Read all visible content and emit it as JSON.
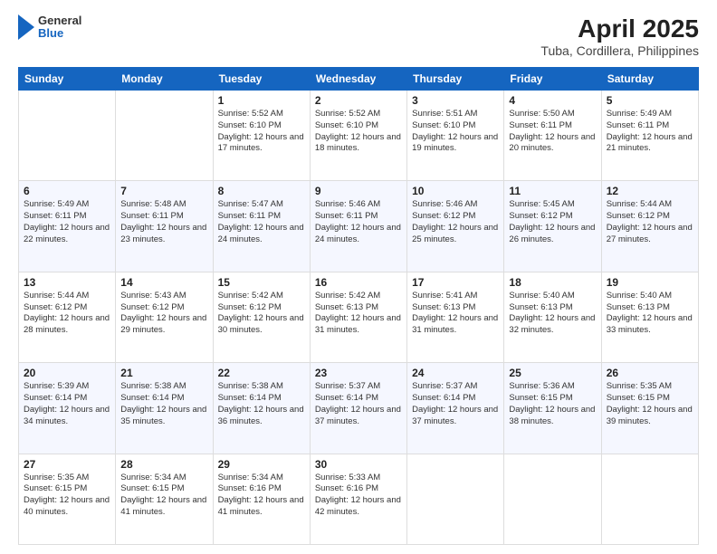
{
  "header": {
    "logo_general": "General",
    "logo_blue": "Blue",
    "title": "April 2025",
    "subtitle": "Tuba, Cordillera, Philippines"
  },
  "columns": [
    "Sunday",
    "Monday",
    "Tuesday",
    "Wednesday",
    "Thursday",
    "Friday",
    "Saturday"
  ],
  "weeks": [
    [
      {
        "day": "",
        "sunrise": "",
        "sunset": "",
        "daylight": ""
      },
      {
        "day": "",
        "sunrise": "",
        "sunset": "",
        "daylight": ""
      },
      {
        "day": "1",
        "sunrise": "Sunrise: 5:52 AM",
        "sunset": "Sunset: 6:10 PM",
        "daylight": "Daylight: 12 hours and 17 minutes."
      },
      {
        "day": "2",
        "sunrise": "Sunrise: 5:52 AM",
        "sunset": "Sunset: 6:10 PM",
        "daylight": "Daylight: 12 hours and 18 minutes."
      },
      {
        "day": "3",
        "sunrise": "Sunrise: 5:51 AM",
        "sunset": "Sunset: 6:10 PM",
        "daylight": "Daylight: 12 hours and 19 minutes."
      },
      {
        "day": "4",
        "sunrise": "Sunrise: 5:50 AM",
        "sunset": "Sunset: 6:11 PM",
        "daylight": "Daylight: 12 hours and 20 minutes."
      },
      {
        "day": "5",
        "sunrise": "Sunrise: 5:49 AM",
        "sunset": "Sunset: 6:11 PM",
        "daylight": "Daylight: 12 hours and 21 minutes."
      }
    ],
    [
      {
        "day": "6",
        "sunrise": "Sunrise: 5:49 AM",
        "sunset": "Sunset: 6:11 PM",
        "daylight": "Daylight: 12 hours and 22 minutes."
      },
      {
        "day": "7",
        "sunrise": "Sunrise: 5:48 AM",
        "sunset": "Sunset: 6:11 PM",
        "daylight": "Daylight: 12 hours and 23 minutes."
      },
      {
        "day": "8",
        "sunrise": "Sunrise: 5:47 AM",
        "sunset": "Sunset: 6:11 PM",
        "daylight": "Daylight: 12 hours and 24 minutes."
      },
      {
        "day": "9",
        "sunrise": "Sunrise: 5:46 AM",
        "sunset": "Sunset: 6:11 PM",
        "daylight": "Daylight: 12 hours and 24 minutes."
      },
      {
        "day": "10",
        "sunrise": "Sunrise: 5:46 AM",
        "sunset": "Sunset: 6:12 PM",
        "daylight": "Daylight: 12 hours and 25 minutes."
      },
      {
        "day": "11",
        "sunrise": "Sunrise: 5:45 AM",
        "sunset": "Sunset: 6:12 PM",
        "daylight": "Daylight: 12 hours and 26 minutes."
      },
      {
        "day": "12",
        "sunrise": "Sunrise: 5:44 AM",
        "sunset": "Sunset: 6:12 PM",
        "daylight": "Daylight: 12 hours and 27 minutes."
      }
    ],
    [
      {
        "day": "13",
        "sunrise": "Sunrise: 5:44 AM",
        "sunset": "Sunset: 6:12 PM",
        "daylight": "Daylight: 12 hours and 28 minutes."
      },
      {
        "day": "14",
        "sunrise": "Sunrise: 5:43 AM",
        "sunset": "Sunset: 6:12 PM",
        "daylight": "Daylight: 12 hours and 29 minutes."
      },
      {
        "day": "15",
        "sunrise": "Sunrise: 5:42 AM",
        "sunset": "Sunset: 6:12 PM",
        "daylight": "Daylight: 12 hours and 30 minutes."
      },
      {
        "day": "16",
        "sunrise": "Sunrise: 5:42 AM",
        "sunset": "Sunset: 6:13 PM",
        "daylight": "Daylight: 12 hours and 31 minutes."
      },
      {
        "day": "17",
        "sunrise": "Sunrise: 5:41 AM",
        "sunset": "Sunset: 6:13 PM",
        "daylight": "Daylight: 12 hours and 31 minutes."
      },
      {
        "day": "18",
        "sunrise": "Sunrise: 5:40 AM",
        "sunset": "Sunset: 6:13 PM",
        "daylight": "Daylight: 12 hours and 32 minutes."
      },
      {
        "day": "19",
        "sunrise": "Sunrise: 5:40 AM",
        "sunset": "Sunset: 6:13 PM",
        "daylight": "Daylight: 12 hours and 33 minutes."
      }
    ],
    [
      {
        "day": "20",
        "sunrise": "Sunrise: 5:39 AM",
        "sunset": "Sunset: 6:14 PM",
        "daylight": "Daylight: 12 hours and 34 minutes."
      },
      {
        "day": "21",
        "sunrise": "Sunrise: 5:38 AM",
        "sunset": "Sunset: 6:14 PM",
        "daylight": "Daylight: 12 hours and 35 minutes."
      },
      {
        "day": "22",
        "sunrise": "Sunrise: 5:38 AM",
        "sunset": "Sunset: 6:14 PM",
        "daylight": "Daylight: 12 hours and 36 minutes."
      },
      {
        "day": "23",
        "sunrise": "Sunrise: 5:37 AM",
        "sunset": "Sunset: 6:14 PM",
        "daylight": "Daylight: 12 hours and 37 minutes."
      },
      {
        "day": "24",
        "sunrise": "Sunrise: 5:37 AM",
        "sunset": "Sunset: 6:14 PM",
        "daylight": "Daylight: 12 hours and 37 minutes."
      },
      {
        "day": "25",
        "sunrise": "Sunrise: 5:36 AM",
        "sunset": "Sunset: 6:15 PM",
        "daylight": "Daylight: 12 hours and 38 minutes."
      },
      {
        "day": "26",
        "sunrise": "Sunrise: 5:35 AM",
        "sunset": "Sunset: 6:15 PM",
        "daylight": "Daylight: 12 hours and 39 minutes."
      }
    ],
    [
      {
        "day": "27",
        "sunrise": "Sunrise: 5:35 AM",
        "sunset": "Sunset: 6:15 PM",
        "daylight": "Daylight: 12 hours and 40 minutes."
      },
      {
        "day": "28",
        "sunrise": "Sunrise: 5:34 AM",
        "sunset": "Sunset: 6:15 PM",
        "daylight": "Daylight: 12 hours and 41 minutes."
      },
      {
        "day": "29",
        "sunrise": "Sunrise: 5:34 AM",
        "sunset": "Sunset: 6:16 PM",
        "daylight": "Daylight: 12 hours and 41 minutes."
      },
      {
        "day": "30",
        "sunrise": "Sunrise: 5:33 AM",
        "sunset": "Sunset: 6:16 PM",
        "daylight": "Daylight: 12 hours and 42 minutes."
      },
      {
        "day": "",
        "sunrise": "",
        "sunset": "",
        "daylight": ""
      },
      {
        "day": "",
        "sunrise": "",
        "sunset": "",
        "daylight": ""
      },
      {
        "day": "",
        "sunrise": "",
        "sunset": "",
        "daylight": ""
      }
    ]
  ]
}
